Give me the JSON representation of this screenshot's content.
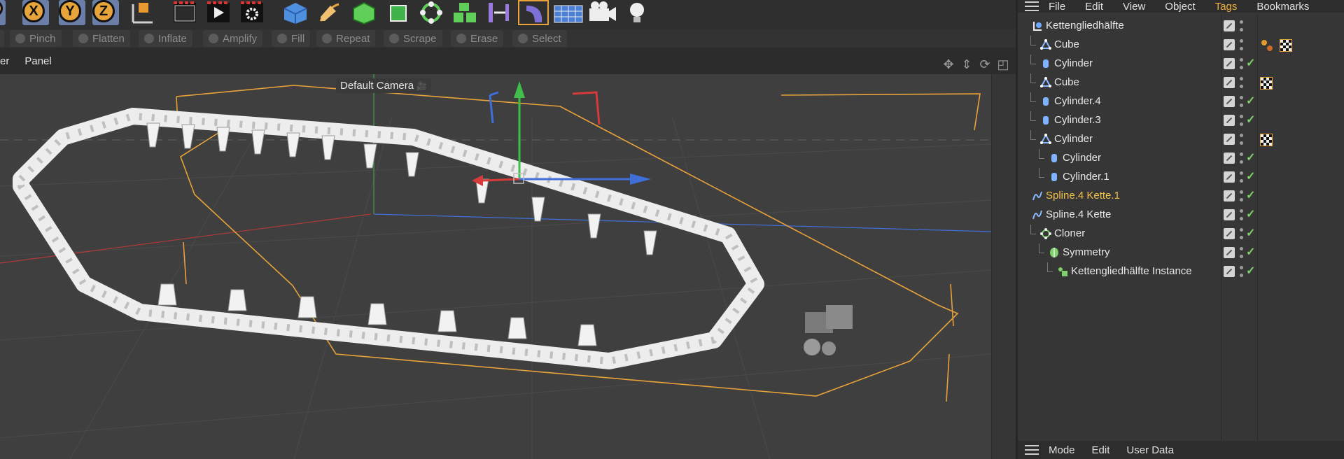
{
  "toolbar": {
    "axis_buttons": [
      "X",
      "Y",
      "Z"
    ],
    "sculpt_tools": [
      "Pinch",
      "Flatten",
      "Inflate",
      "Amplify",
      "Fill",
      "Repeat",
      "Scrape",
      "Erase",
      "Select"
    ]
  },
  "viewport": {
    "menus": [
      "er",
      "Panel"
    ],
    "camera_label": "Default Camera"
  },
  "object_manager": {
    "menus": [
      "File",
      "Edit",
      "View",
      "Object",
      "Tags",
      "Bookmarks"
    ],
    "active_menu": "Tags",
    "bottom_menus": [
      "Mode",
      "Edit",
      "User Data"
    ],
    "rows": [
      {
        "name": "Kettengliedhälfte",
        "level": 0,
        "icon": "null-icon",
        "checked": false,
        "tags": []
      },
      {
        "name": "Cube",
        "level": 1,
        "icon": "cube-object-icon",
        "checked": false,
        "tags": [
          "material-dots-tag",
          "checker-tag"
        ]
      },
      {
        "name": "Cylinder",
        "level": 1,
        "icon": "cylinder-icon",
        "checked": true,
        "tags": []
      },
      {
        "name": "Cube",
        "level": 1,
        "icon": "cube-object-icon",
        "checked": false,
        "tags": [
          "checker-tag"
        ]
      },
      {
        "name": "Cylinder.4",
        "level": 1,
        "icon": "cylinder-icon",
        "checked": true,
        "tags": []
      },
      {
        "name": "Cylinder.3",
        "level": 1,
        "icon": "cylinder-icon",
        "checked": true,
        "tags": []
      },
      {
        "name": "Cylinder",
        "level": 1,
        "icon": "cube-object-icon",
        "checked": false,
        "tags": [
          "checker-tag"
        ]
      },
      {
        "name": "Cylinder",
        "level": 2,
        "icon": "cylinder-icon",
        "checked": true,
        "tags": []
      },
      {
        "name": "Cylinder.1",
        "level": 2,
        "icon": "cylinder-icon",
        "checked": true,
        "tags": []
      },
      {
        "name": "Spline.4 Kette.1",
        "level": 0,
        "icon": "spline-icon",
        "checked": true,
        "highlight": true,
        "tags": []
      },
      {
        "name": "Spline.4 Kette",
        "level": 0,
        "icon": "spline-icon",
        "checked": true,
        "tags": []
      },
      {
        "name": "Cloner",
        "level": 1,
        "icon": "cloner-icon",
        "checked": true,
        "tags": []
      },
      {
        "name": "Symmetry",
        "level": 2,
        "icon": "symmetry-icon",
        "checked": true,
        "tags": []
      },
      {
        "name": "Kettengliedhälfte Instance",
        "level": 3,
        "icon": "instance-icon",
        "checked": true,
        "tags": []
      }
    ]
  },
  "colors": {
    "accent": "#f1b23b",
    "check": "#7fd16b",
    "spline": "#e8a23a",
    "axis_x": "#d63a3a",
    "axis_y": "#3fbf4a",
    "axis_z": "#3f6fd9"
  }
}
